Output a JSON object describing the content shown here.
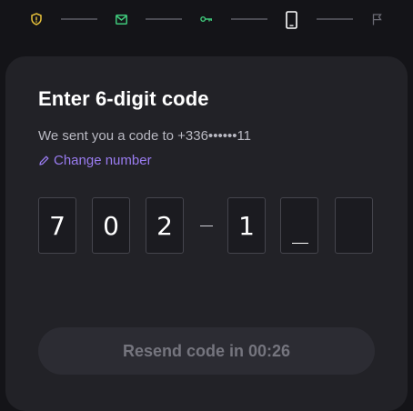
{
  "stepper": {
    "steps": [
      {
        "icon": "shield-icon",
        "state": "done",
        "color": "#e8c23a"
      },
      {
        "icon": "mail-icon",
        "state": "done",
        "color": "#3fc77a"
      },
      {
        "icon": "key-icon",
        "state": "done",
        "color": "#3fc77a"
      },
      {
        "icon": "phone-icon",
        "state": "current",
        "color": "#ffffff"
      },
      {
        "icon": "flag-icon",
        "state": "upcoming",
        "color": "#6b6b74"
      }
    ]
  },
  "card": {
    "title": "Enter 6-digit code",
    "subtitle": "We sent you a code to +336••••••11",
    "change_number_label": "Change number",
    "accent_color": "#9a7cf0"
  },
  "code": {
    "digits": [
      "7",
      "0",
      "2",
      "1",
      "",
      ""
    ],
    "active_index": 4,
    "separator": "–"
  },
  "resend": {
    "label": "Resend code in 00:26",
    "disabled": true
  }
}
